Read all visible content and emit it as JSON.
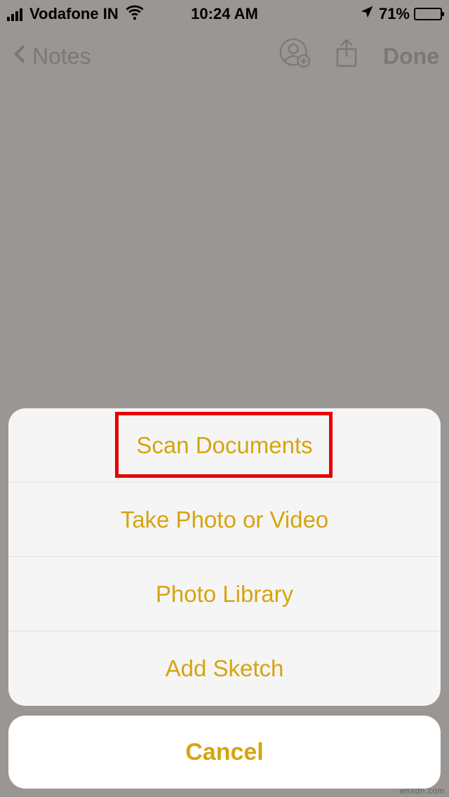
{
  "status": {
    "carrier": "Vodafone IN",
    "time": "10:24 AM",
    "battery_pct": "71%"
  },
  "nav": {
    "back_label": "Notes",
    "done_label": "Done"
  },
  "sheet": {
    "items": [
      {
        "label": "Scan Documents"
      },
      {
        "label": "Take Photo or Video"
      },
      {
        "label": "Photo Library"
      },
      {
        "label": "Add Sketch"
      }
    ],
    "cancel_label": "Cancel"
  },
  "watermark": "wsxdn.com"
}
